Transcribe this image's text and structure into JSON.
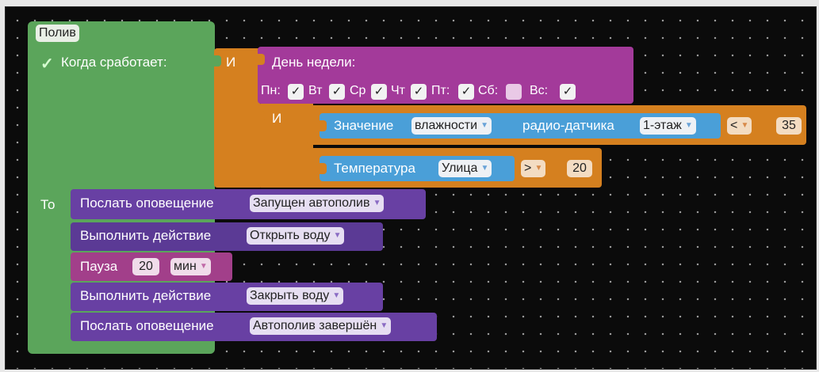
{
  "rule": {
    "title": "Полив",
    "when_label": "Когда сработает:",
    "when_check": "✓",
    "to_label": "То"
  },
  "and_outer": "И",
  "weekday": {
    "label": "День недели:",
    "days": [
      {
        "label": "Пн:",
        "checked": true,
        "mark": "✓"
      },
      {
        "label": "Вт",
        "checked": true,
        "mark": "✓"
      },
      {
        "label": "Ср",
        "checked": true,
        "mark": "✓"
      },
      {
        "label": "Чт",
        "checked": true,
        "mark": "✓"
      },
      {
        "label": "Пт:",
        "checked": true,
        "mark": "✓"
      },
      {
        "label": "Сб:",
        "checked": false,
        "mark": ""
      },
      {
        "label": "Вс:",
        "checked": true,
        "mark": "✓"
      }
    ]
  },
  "and_inner": "И",
  "humidity": {
    "prefix": "Значение",
    "param": "влажности",
    "middle": "радио-датчика",
    "sensor": "1-этаж",
    "operator": "<",
    "value": "35"
  },
  "temperature": {
    "prefix": "Температура",
    "location": "Улица",
    "operator": ">",
    "value": "20"
  },
  "actions": [
    {
      "label": "Послать оповещение",
      "value": "Запущен автополив"
    },
    {
      "label": "Выполнить действие",
      "value": "Открыть воду"
    },
    {
      "label": "Пауза",
      "value": "20",
      "unit": "мин"
    },
    {
      "label": "Выполнить действие",
      "value": "Закрыть воду"
    },
    {
      "label": "Послать оповещение",
      "value": "Автополив завершён"
    }
  ],
  "colors": {
    "rule": "#5ba55b",
    "logic": "#d5801f",
    "weekday": "#a33a9a",
    "sensor": "#4a9fd8",
    "action": "#6840a3",
    "pause": "#a23f8a"
  }
}
